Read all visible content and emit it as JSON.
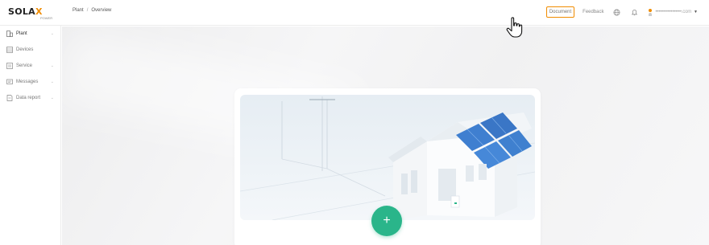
{
  "header": {
    "logo_main": "SOLA",
    "logo_x": "X",
    "logo_sub": "POWER",
    "breadcrumb": [
      "Plant",
      "/",
      "Overview"
    ],
    "document_label": "Document",
    "feedback_label": "Feedback",
    "user_name": "•••••••••••••••••.com"
  },
  "sidebar": {
    "items": [
      {
        "label": "Plant",
        "icon": "plant-icon",
        "has_chevron": true
      },
      {
        "label": "Devices",
        "icon": "devices-icon",
        "has_chevron": false
      },
      {
        "label": "Service",
        "icon": "service-icon",
        "has_chevron": true
      },
      {
        "label": "Messages",
        "icon": "messages-icon",
        "has_chevron": true
      },
      {
        "label": "Data report",
        "icon": "data-report-icon",
        "has_chevron": true
      }
    ]
  },
  "main": {
    "add_button_label": "+"
  },
  "colors": {
    "accent": "#f08c00",
    "add_button": "#2ab58a"
  }
}
